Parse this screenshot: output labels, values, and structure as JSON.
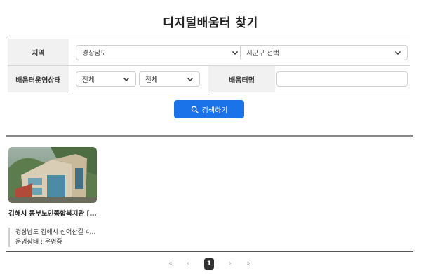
{
  "page": {
    "title": "디지털배움터 찾기"
  },
  "search": {
    "region_label": "지역",
    "province_value": "경상남도",
    "district_placeholder": "시군구 선택",
    "status_label": "배움터운영상태",
    "status_value_1": "전체",
    "status_value_2": "전체",
    "name_label": "배움터명",
    "name_value": "",
    "button_label": "검색하기"
  },
  "results": [
    {
      "title": "김해시 동부노인종합복지관 […",
      "address": "경상남도 김해시 신어산길 4…",
      "status": "운영상태 : 운영중"
    }
  ],
  "pagination": {
    "first": "«",
    "prev": "‹",
    "current": "1",
    "next": "›",
    "last": "»"
  },
  "colors": {
    "accent": "#1a73e8",
    "header_bg": "#f1f1f1"
  }
}
